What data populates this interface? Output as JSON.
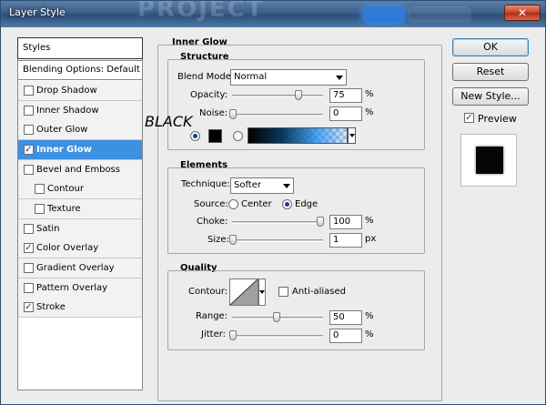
{
  "window": {
    "title": "Layer Style",
    "close_symbol": "✕",
    "background_title_text": "PROJECT"
  },
  "sidebar": {
    "header": "Styles",
    "blending": "Blending Options: Default",
    "items": [
      {
        "label": "Drop Shadow",
        "checked": false
      },
      {
        "label": "Inner Shadow",
        "checked": false
      },
      {
        "label": "Outer Glow",
        "checked": false
      },
      {
        "label": "Inner Glow",
        "checked": true,
        "selected": true
      },
      {
        "label": "Bevel and Emboss",
        "checked": false
      },
      {
        "label": "Contour",
        "checked": false,
        "sub": true
      },
      {
        "label": "Texture",
        "checked": false,
        "sub": true
      },
      {
        "label": "Satin",
        "checked": false
      },
      {
        "label": "Color Overlay",
        "checked": true
      },
      {
        "label": "Gradient Overlay",
        "checked": false
      },
      {
        "label": "Pattern Overlay",
        "checked": false
      },
      {
        "label": "Stroke",
        "checked": true
      }
    ]
  },
  "panel": {
    "title": "Inner Glow",
    "structure": {
      "title": "Structure",
      "blend_mode_label": "Blend Mode:",
      "blend_mode_value": "Normal",
      "opacity_label": "Opacity:",
      "opacity_value": "75",
      "opacity_unit": "%",
      "opacity_level": 0.75,
      "noise_label": "Noise:",
      "noise_value": "0",
      "noise_unit": "%",
      "noise_level": 0.0,
      "overlay_text": "BLACK",
      "color_swatch": "#000000"
    },
    "elements": {
      "title": "Elements",
      "technique_label": "Technique:",
      "technique_value": "Softer",
      "source_label": "Source:",
      "source_center": "Center",
      "source_edge": "Edge",
      "choke_label": "Choke:",
      "choke_value": "100",
      "choke_unit": "%",
      "choke_level": 1.0,
      "size_label": "Size:",
      "size_value": "1",
      "size_unit": "px"
    },
    "quality": {
      "title": "Quality",
      "contour_label": "Contour:",
      "anti_aliased": "Anti-aliased",
      "range_label": "Range:",
      "range_value": "50",
      "range_unit": "%",
      "range_level": 0.5,
      "jitter_label": "Jitter:",
      "jitter_value": "0",
      "jitter_unit": "%",
      "jitter_level": 0.0
    }
  },
  "buttons": {
    "ok": "OK",
    "reset": "Reset",
    "new_style": "New Style...",
    "preview": "Preview"
  }
}
